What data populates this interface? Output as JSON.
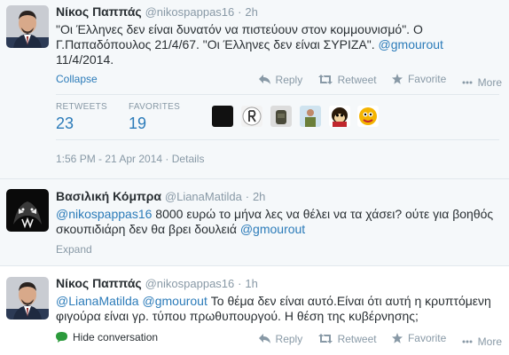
{
  "tweets": [
    {
      "fullname": "Νίκος Παππάς",
      "username": "@nikospappas16",
      "dot": "·",
      "time": "2h",
      "line1": "\"Οι Έλληνες δεν είναι δυνατόν να πιστεύουν στον κομμουνισμό\". Ο",
      "line2_text": "Γ.Παπαδόπουλος 21/4/67. \"Οι Έλληνες δεν είναι ΣΥΡΙΖΑ\". ",
      "line2_link": "@gmourout",
      "line3": "11/4/2014.",
      "toggle": "Collapse",
      "retweets_label": "RETWEETS",
      "retweets_value": "23",
      "favorites_label": "FAVORITES",
      "favorites_value": "19",
      "timestamp": "1:56 PM - 21 Apr 2014",
      "details": "Details"
    },
    {
      "fullname": "Βασιλική Κόμπρα",
      "username": "@LianaMatilda",
      "dot": "·",
      "time": "2h",
      "line1_link": "@nikospappas16",
      "line1_text": " 8000 ευρώ το μήνα λες να θέλει να τα χάσει? ούτε για βοηθός",
      "line2_text": "σκουπιδιάρη δεν θα βρει δουλειά ",
      "line2_link": "@gmourout",
      "toggle": "Expand"
    },
    {
      "fullname": "Νίκος Παππάς",
      "username": "@nikospappas16",
      "dot": "·",
      "time": "1h",
      "line1_link": "@LianaMatilda",
      "line1_sep": " ",
      "line1_link2": "@gmourout",
      "line1_text": " Το θέμα δεν είναι αυτό.Είναι ότι αυτή η κρυπτόμενη",
      "line2": "φιγούρα είναι γρ. τύπου πρωθυπουργού. Η θέση της κυβέρνησης;",
      "toggle": "Hide conversation"
    }
  ],
  "actions": {
    "reply": "Reply",
    "retweet": "Retweet",
    "favorite": "Favorite",
    "more": "More"
  },
  "colors": {
    "link": "#2b7bb9",
    "muted": "#8899a6",
    "text": "#292f33",
    "conversation_bg": "#f5f8fa",
    "hide_conversation_icon": "#2b9a3b"
  },
  "icons": [
    "reply-icon",
    "retweet-icon",
    "favorite-star-icon",
    "more-dots-icon",
    "conversation-bubble-icon"
  ]
}
